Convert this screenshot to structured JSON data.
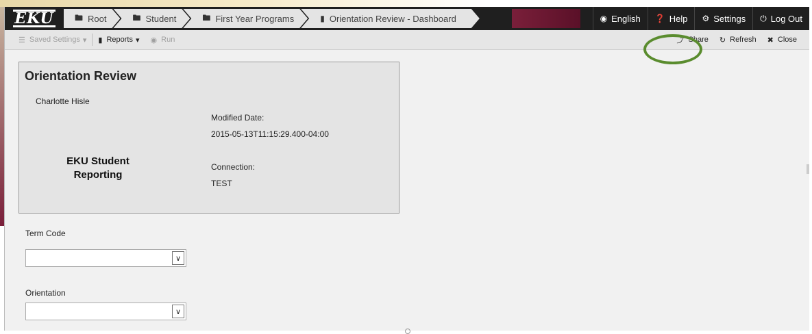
{
  "logo": "EKU",
  "breadcrumbs": [
    {
      "icon": "folder-icon",
      "label": "Root"
    },
    {
      "icon": "folder-icon",
      "label": "Student"
    },
    {
      "icon": "folder-icon",
      "label": "First Year Programs"
    },
    {
      "icon": "document-icon",
      "label": "Orientation Review - Dashboard"
    }
  ],
  "nav_right": {
    "language": "English",
    "help": "Help",
    "settings": "Settings",
    "logout": "Log Out"
  },
  "toolbar": {
    "saved_settings": "Saved Settings",
    "reports": "Reports",
    "run": "Run",
    "share": "Share",
    "refresh": "Refresh",
    "close": "Close"
  },
  "dashboard": {
    "title": "Orientation Review",
    "author": "Charlotte Hisle",
    "modified_label": "Modified Date:",
    "modified_value": "2015-05-13T11:15:29.400-04:00",
    "org_line1": "EKU Student",
    "org_line2": "Reporting",
    "connection_label": "Connection:",
    "connection_value": "TEST"
  },
  "form": {
    "term_code_label": "Term Code",
    "term_code_value": "",
    "orientation_label": "Orientation",
    "orientation_value": ""
  },
  "colors": {
    "nav_bg": "#1f1f1f",
    "accent_maroon": "#7a1f3a",
    "highlight_ring": "#5a8c2e"
  }
}
